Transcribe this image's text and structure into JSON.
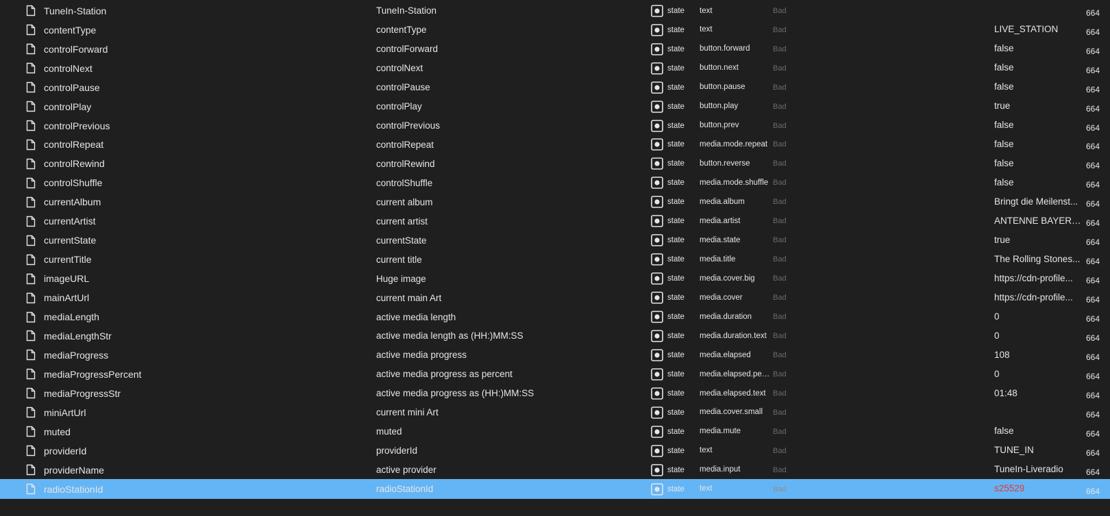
{
  "rows": [
    {
      "id": "TuneIn-Station",
      "name": "TuneIn-Station",
      "type": "state",
      "role": "text",
      "quality": "Bad",
      "value": "",
      "ack": "664",
      "icon": "file-icon",
      "type_icon": "state-icon"
    },
    {
      "id": "contentType",
      "name": "contentType",
      "type": "state",
      "role": "text",
      "quality": "Bad",
      "value": "LIVE_STATION",
      "ack": "664",
      "icon": "file-icon",
      "type_icon": "state-icon"
    },
    {
      "id": "controlForward",
      "name": "controlForward",
      "type": "state",
      "role": "button.forward",
      "quality": "Bad",
      "value": "false",
      "ack": "664",
      "icon": "file-icon",
      "type_icon": "state-icon"
    },
    {
      "id": "controlNext",
      "name": "controlNext",
      "type": "state",
      "role": "button.next",
      "quality": "Bad",
      "value": "false",
      "ack": "664",
      "icon": "file-icon",
      "type_icon": "state-icon"
    },
    {
      "id": "controlPause",
      "name": "controlPause",
      "type": "state",
      "role": "button.pause",
      "quality": "Bad",
      "value": "false",
      "ack": "664",
      "icon": "file-icon",
      "type_icon": "state-icon"
    },
    {
      "id": "controlPlay",
      "name": "controlPlay",
      "type": "state",
      "role": "button.play",
      "quality": "Bad",
      "value": "true",
      "ack": "664",
      "icon": "file-icon",
      "type_icon": "state-icon"
    },
    {
      "id": "controlPrevious",
      "name": "controlPrevious",
      "type": "state",
      "role": "button.prev",
      "quality": "Bad",
      "value": "false",
      "ack": "664",
      "icon": "file-icon",
      "type_icon": "state-icon"
    },
    {
      "id": "controlRepeat",
      "name": "controlRepeat",
      "type": "state",
      "role": "media.mode.repeat",
      "quality": "Bad",
      "value": "false",
      "ack": "664",
      "icon": "file-icon",
      "type_icon": "state-icon"
    },
    {
      "id": "controlRewind",
      "name": "controlRewind",
      "type": "state",
      "role": "button.reverse",
      "quality": "Bad",
      "value": "false",
      "ack": "664",
      "icon": "file-icon",
      "type_icon": "state-icon"
    },
    {
      "id": "controlShuffle",
      "name": "controlShuffle",
      "type": "state",
      "role": "media.mode.shuffle",
      "quality": "Bad",
      "value": "false",
      "ack": "664",
      "icon": "file-icon",
      "type_icon": "state-icon"
    },
    {
      "id": "currentAlbum",
      "name": "current album",
      "type": "state",
      "role": "media.album",
      "quality": "Bad",
      "value": "Bringt die Meilenst...",
      "ack": "664",
      "icon": "file-icon",
      "type_icon": "state-icon"
    },
    {
      "id": "currentArtist",
      "name": "current artist",
      "type": "state",
      "role": "media.artist",
      "quality": "Bad",
      "value": "ANTENNE BAYERN...",
      "ack": "664",
      "icon": "file-icon",
      "type_icon": "state-icon"
    },
    {
      "id": "currentState",
      "name": "currentState",
      "type": "state",
      "role": "media.state",
      "quality": "Bad",
      "value": "true",
      "ack": "664",
      "icon": "file-icon",
      "type_icon": "state-icon"
    },
    {
      "id": "currentTitle",
      "name": "current title",
      "type": "state",
      "role": "media.title",
      "quality": "Bad",
      "value": "The Rolling Stones...",
      "ack": "664",
      "icon": "file-icon",
      "type_icon": "state-icon"
    },
    {
      "id": "imageURL",
      "name": "Huge image",
      "type": "state",
      "role": "media.cover.big",
      "quality": "Bad",
      "value": "https://cdn-profile...",
      "ack": "664",
      "icon": "file-icon",
      "type_icon": "state-icon"
    },
    {
      "id": "mainArtUrl",
      "name": "current main Art",
      "type": "state",
      "role": "media.cover",
      "quality": "Bad",
      "value": "https://cdn-profile...",
      "ack": "664",
      "icon": "file-icon",
      "type_icon": "state-icon"
    },
    {
      "id": "mediaLength",
      "name": "active media length",
      "type": "state",
      "role": "media.duration",
      "quality": "Bad",
      "value": "0",
      "ack": "664",
      "icon": "file-icon",
      "type_icon": "state-icon"
    },
    {
      "id": "mediaLengthStr",
      "name": "active media length as (HH:)MM:SS",
      "type": "state",
      "role": "media.duration.text",
      "quality": "Bad",
      "value": "0",
      "ack": "664",
      "icon": "file-icon",
      "type_icon": "state-icon"
    },
    {
      "id": "mediaProgress",
      "name": "active media progress",
      "type": "state",
      "role": "media.elapsed",
      "quality": "Bad",
      "value": "108",
      "ack": "664",
      "icon": "file-icon",
      "type_icon": "state-icon"
    },
    {
      "id": "mediaProgressPercent",
      "name": "active media progress as percent",
      "type": "state",
      "role": "media.elapsed.per...",
      "quality": "Bad",
      "value": "0",
      "ack": "664",
      "icon": "file-icon",
      "type_icon": "state-icon"
    },
    {
      "id": "mediaProgressStr",
      "name": "active media progress as (HH:)MM:SS",
      "type": "state",
      "role": "media.elapsed.text",
      "quality": "Bad",
      "value": "01:48",
      "ack": "664",
      "icon": "file-icon",
      "type_icon": "state-icon"
    },
    {
      "id": "miniArtUrl",
      "name": "current mini Art",
      "type": "state",
      "role": "media.cover.small",
      "quality": "Bad",
      "value": "",
      "ack": "664",
      "icon": "file-icon",
      "type_icon": "state-icon"
    },
    {
      "id": "muted",
      "name": "muted",
      "type": "state",
      "role": "media.mute",
      "quality": "Bad",
      "value": "false",
      "ack": "664",
      "icon": "file-icon",
      "type_icon": "state-icon"
    },
    {
      "id": "providerId",
      "name": "providerId",
      "type": "state",
      "role": "text",
      "quality": "Bad",
      "value": "TUNE_IN",
      "ack": "664",
      "icon": "file-icon",
      "type_icon": "state-icon"
    },
    {
      "id": "providerName",
      "name": "active provider",
      "type": "state",
      "role": "media.input",
      "quality": "Bad",
      "value": "TuneIn-Liveradio",
      "ack": "664",
      "icon": "file-icon",
      "type_icon": "state-icon"
    },
    {
      "id": "radioStationId",
      "name": "radioStationId",
      "type": "state",
      "role": "text",
      "quality": "Bad",
      "value": "s25529",
      "ack": "664",
      "icon": "file-icon",
      "type_icon": "state-icon",
      "selected": true
    }
  ],
  "colors": {
    "background": "#1f1f1f",
    "selected_row": "#64b5f6",
    "text": "#e6e6e6",
    "quality_text": "#6b6b6b",
    "selected_value": "#e53935"
  }
}
